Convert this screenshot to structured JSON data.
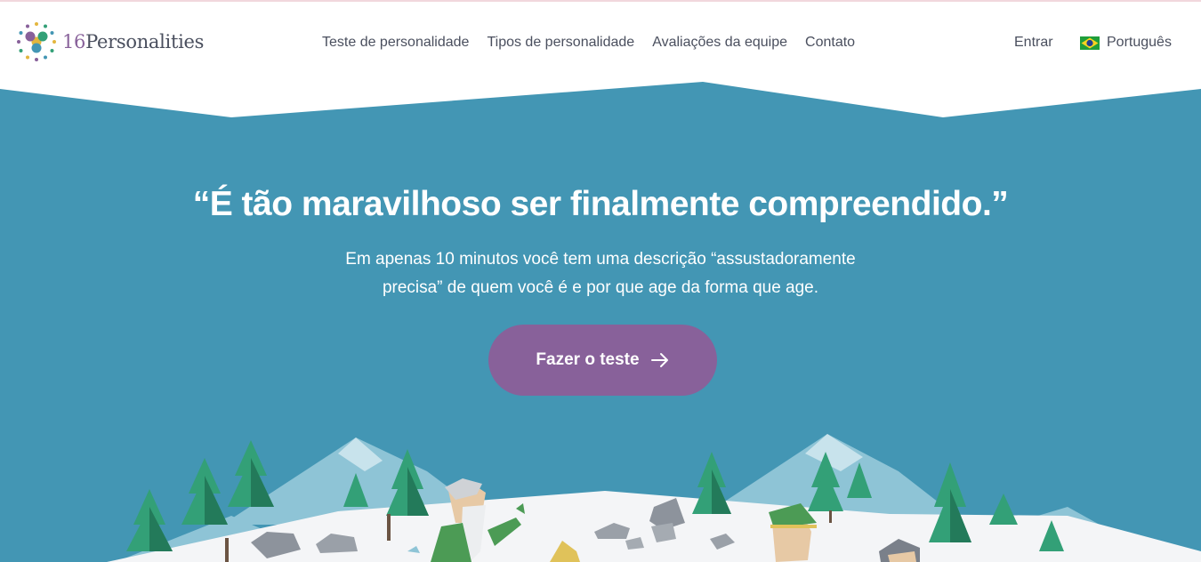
{
  "brand": {
    "num": "16",
    "name": "Personalities"
  },
  "nav": {
    "items": [
      "Teste de personalidade",
      "Tipos de personalidade",
      "Avaliações da equipe",
      "Contato"
    ],
    "login": "Entrar",
    "language": "Português"
  },
  "hero": {
    "headline": "“É tão maravilhoso ser finalmente compreendido.”",
    "subtitle": "Em apenas 10 minutos você tem uma descrição “assustadoramente precisa” de quem você é e por que age da forma que age.",
    "cta_label": "Fazer o teste"
  },
  "colors": {
    "sky": "#4396b4",
    "accent": "#88619a",
    "snow": "#f4f5f7",
    "tree": "#33a077"
  },
  "icons": [
    "logo-dots-icon",
    "brazil-flag-icon",
    "arrow-right-icon"
  ]
}
